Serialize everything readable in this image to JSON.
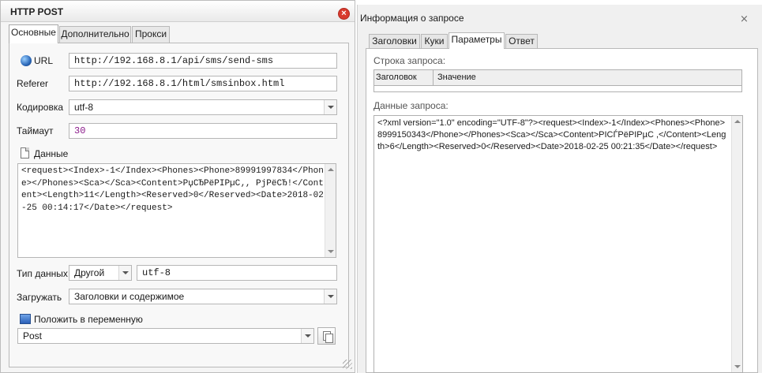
{
  "left_panel": {
    "title": "HTTP POST",
    "tabs": [
      {
        "label": "Основные"
      },
      {
        "label": "Дополнительно"
      },
      {
        "label": "Прокси"
      }
    ],
    "url": {
      "label": "URL",
      "value": "http://192.168.8.1/api/sms/send-sms"
    },
    "referer": {
      "label": "Referer",
      "value": "http://192.168.8.1/html/smsinbox.html"
    },
    "encoding": {
      "label": "Кодировка",
      "value": "utf-8"
    },
    "timeout": {
      "label": "Таймаут",
      "value": "30"
    },
    "data": {
      "label": "Данные",
      "value": "<request><Index>-1</Index><Phones><Phone>89991997834</Phone></Phones><Sca></Sca><Content>РџСЂРёРІРµС‚, РјРёСЂ!</Content><Length>11</Length><Reserved>0</Reserved><Date>2018-02-25 00:14:17</Date></request>"
    },
    "data_type": {
      "label": "Тип данных",
      "value": "Другой",
      "encoding_value": "utf-8"
    },
    "load": {
      "label": "Загружать",
      "value": "Заголовки и содержимое"
    },
    "save_to_variable": {
      "label": "Положить в переменную",
      "value": "Post"
    }
  },
  "right_panel": {
    "title": "Информация о запросе",
    "close_symbol": "⨯",
    "tabs": [
      {
        "label": "Заголовки"
      },
      {
        "label": "Куки"
      },
      {
        "label": "Параметры"
      },
      {
        "label": "Ответ"
      }
    ],
    "request_line_label": "Строка запроса:",
    "grid_headers": {
      "header": "Заголовок",
      "value": "Значение"
    },
    "request_data_label": "Данные запроса:",
    "request_data_value": "<?xml version=\"1.0\" encoding=\"UTF-8\"?><request><Index>-1</Index><Phones><Phone>8999150343</Phone></Phones><Sca></Sca><Content>РІСЃРёРІРµС ,</Content><Length>6</Length><Reserved>0</Reserved><Date>2018-02-25 00:21:35</Date></request>"
  },
  "colors": {
    "close_button": "#d83b2e",
    "highlight_text": "#8b1a8b"
  }
}
